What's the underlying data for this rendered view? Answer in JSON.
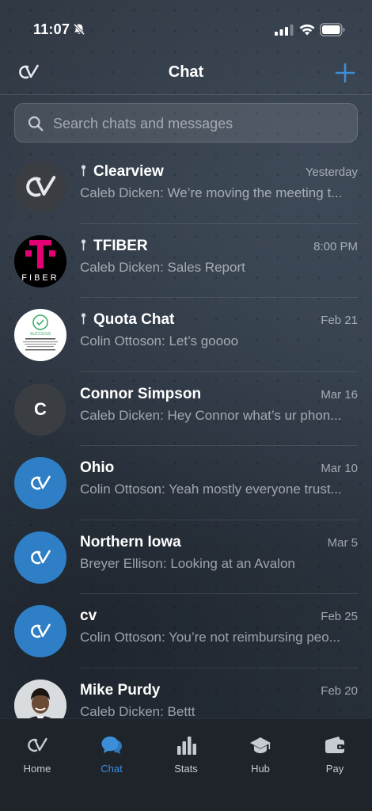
{
  "status_bar": {
    "time": "11:07"
  },
  "header": {
    "title": "Chat",
    "logo": "cv-logo-icon",
    "action_icon": "plus-icon"
  },
  "search": {
    "placeholder": "Search chats and messages",
    "value": ""
  },
  "colors": {
    "accent": "#3d8ed8",
    "avatar_blue": "#2e7fc5",
    "avatar_dark": "#3a3d42",
    "tab_bar": "#1f242b"
  },
  "chats": [
    {
      "name": "Clearview",
      "pinned": true,
      "time": "Yesterday",
      "preview": "Caleb Dicken: We’re moving the meeting t...",
      "avatar": "cv-logo-gray"
    },
    {
      "name": "TFIBER",
      "pinned": true,
      "time": "8:00 PM",
      "preview": "Caleb Dicken: Sales Report",
      "avatar": "tfiber-logo",
      "avatar_text": "FIBER"
    },
    {
      "name": "Quota Chat",
      "pinned": true,
      "time": "Feb 21",
      "preview": "Colin Ottoson: Let’s goooo",
      "avatar": "success-screenshot",
      "avatar_text": "SUCCESS"
    },
    {
      "name": "Connor Simpson",
      "pinned": false,
      "time": "Mar 16",
      "preview": "Caleb Dicken: Hey Connor what’s ur phon...",
      "avatar": "initial",
      "initial": "C"
    },
    {
      "name": "Ohio",
      "pinned": false,
      "time": "Mar 10",
      "preview": "Colin Ottoson: Yeah mostly everyone trust...",
      "avatar": "cv-logo-blue"
    },
    {
      "name": "Northern Iowa",
      "pinned": false,
      "time": "Mar 5",
      "preview": "Breyer Ellison: Looking at an Avalon",
      "avatar": "cv-logo-blue"
    },
    {
      "name": "cv",
      "pinned": false,
      "time": "Feb 25",
      "preview": "Colin Ottoson: You’re not reimbursing peo...",
      "avatar": "cv-logo-blue"
    },
    {
      "name": "Mike Purdy",
      "pinned": false,
      "time": "Feb 20",
      "preview": "Caleb Dicken: Bettt",
      "avatar": "person-photo"
    }
  ],
  "tabs": [
    {
      "label": "Home",
      "icon": "cv-logo-icon",
      "active": false
    },
    {
      "label": "Chat",
      "icon": "chat-bubbles-icon",
      "active": true
    },
    {
      "label": "Stats",
      "icon": "bar-chart-icon",
      "active": false
    },
    {
      "label": "Hub",
      "icon": "graduation-cap-icon",
      "active": false
    },
    {
      "label": "Pay",
      "icon": "wallet-icon",
      "active": false
    }
  ]
}
